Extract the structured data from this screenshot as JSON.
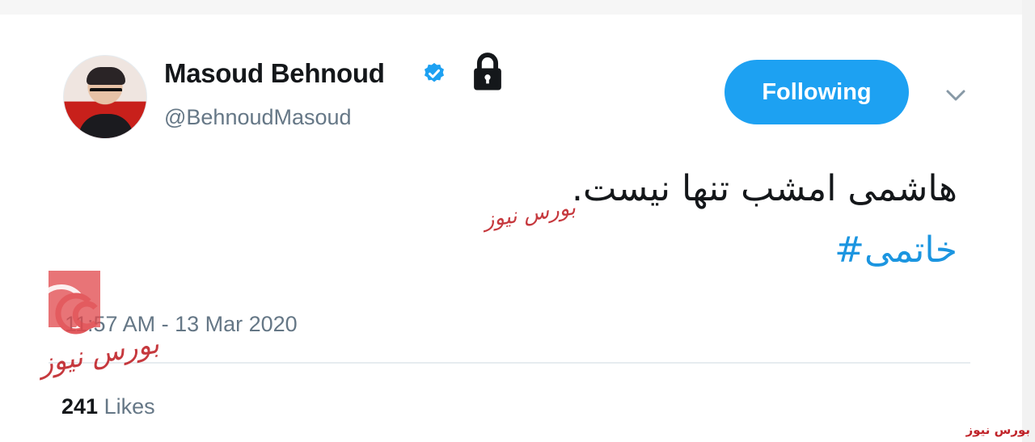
{
  "tweet": {
    "author": {
      "name": "Masoud Behnoud",
      "handle": "@BehnoudMasoud",
      "verified": true,
      "protected": true
    },
    "follow_button_label": "Following",
    "text": "هاشمی امشب تنها نیست.",
    "hashtag": "#خاتمی",
    "timestamp": "11:57 AM - 13 Mar 2020",
    "likes_count": "241",
    "likes_label": "Likes"
  },
  "icons": {
    "verified": "verified-badge-icon",
    "lock": "lock-icon",
    "more": "chevron-down-icon"
  },
  "watermark": {
    "center_text": "بورس نیوز",
    "logo_text": "بورس نیوز",
    "corner_text": "بورس نیوز"
  },
  "colors": {
    "accent": "#1da1f2",
    "hashtag": "#1b95e0",
    "secondary_text": "#657786",
    "watermark": "#c0242a"
  }
}
